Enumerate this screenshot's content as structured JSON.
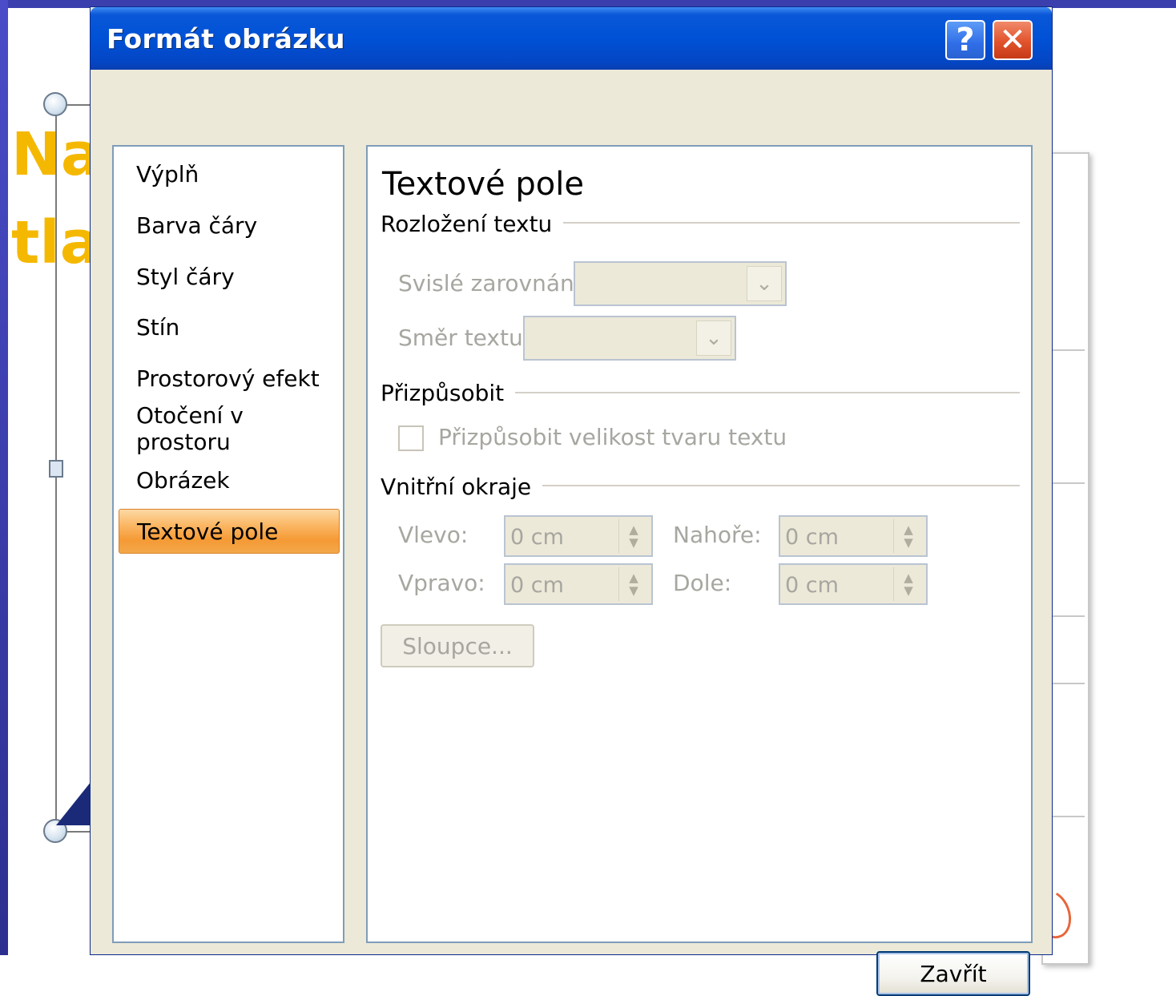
{
  "background_slide": {
    "title_line1": "Na",
    "title_line2": "tla",
    "title_color": "#f5b800"
  },
  "dialog": {
    "title": "Formát obrázku",
    "help_glyph": "?",
    "close_glyph": "✕",
    "titlebar_color": "#0051d6"
  },
  "nav": {
    "items": [
      {
        "label": "Výplň"
      },
      {
        "label": "Barva čáry"
      },
      {
        "label": "Styl čáry"
      },
      {
        "label": "Stín"
      },
      {
        "label": "Prostorový efekt"
      },
      {
        "label": "Otočení v prostoru"
      },
      {
        "label": "Obrázek"
      },
      {
        "label": "Textové pole",
        "selected": true
      }
    ],
    "selected_color": "#f59a35"
  },
  "content": {
    "heading": "Textové pole",
    "sections": {
      "layout": "Rozložení textu",
      "autofit": "Přizpůsobit",
      "margins": "Vnitřní okraje"
    },
    "vertical_alignment": {
      "label": "Svislé zarovnání:",
      "value": ""
    },
    "text_direction": {
      "label": "Směr textu:",
      "value": ""
    },
    "autofit_checkbox": {
      "label": "Přizpůsobit velikost tvaru textu",
      "checked": false
    },
    "margins": {
      "left": {
        "label": "Vlevo:",
        "value": "0 cm"
      },
      "right": {
        "label": "Vpravo:",
        "value": "0 cm"
      },
      "top": {
        "label": "Nahoře:",
        "value": "0 cm"
      },
      "bottom": {
        "label": "Dole:",
        "value": "0 cm"
      }
    },
    "columns_button": "Sloupce..."
  },
  "footer": {
    "close_button": "Zavřít"
  },
  "icons": {
    "chevron": "chevron-down-icon",
    "spin": "spin-up-down-icon"
  }
}
